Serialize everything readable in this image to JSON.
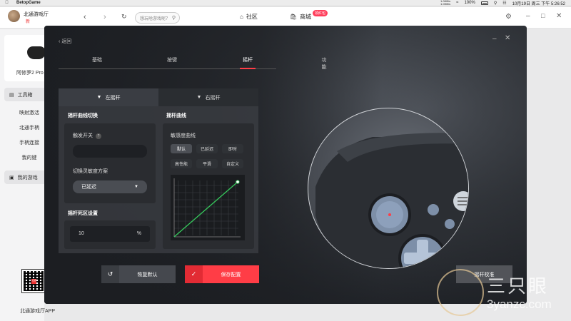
{
  "menubar": {
    "app_name": "BetopGame",
    "net_up": "1.0KB/s",
    "net_down": "1.0KB/s",
    "battery": "100%",
    "datetime": "10月19日 周三 下午 5:26:52"
  },
  "topbar": {
    "user_name": "北通游戏厅",
    "user_sub": "新",
    "search_placeholder": "想玩啥游戏呢？",
    "community_label": "社区",
    "mall_label": "商城",
    "mall_badge": "领红包"
  },
  "sidebar": {
    "device_name": "阿修罗2 Pro",
    "tools_label": "工具箱",
    "items": [
      "映射激活",
      "北通手柄",
      "手柄连接",
      "我的键"
    ],
    "games_label": "我的游戏",
    "qr_logo": "北通",
    "qr_label": "北通游戏厅APP"
  },
  "dialog": {
    "back_label": "返回",
    "tabs": [
      {
        "label": "基础",
        "active": false
      },
      {
        "label": "按键",
        "active": false
      },
      {
        "label": "摇杆",
        "active": true
      },
      {
        "label": "功能",
        "active": false
      }
    ],
    "stick_tabs": [
      {
        "label": "左摇杆",
        "active": true
      },
      {
        "label": "右摇杆",
        "active": false
      }
    ],
    "curve_switch_title": "摇杆曲线切换",
    "trigger_label": "触发开关",
    "sensitivity_scheme_label": "切换灵敏度方案",
    "sensitivity_scheme_value": "已延迟",
    "deadzone_title": "摇杆死区设置",
    "deadzone_value": "10",
    "deadzone_unit": "%",
    "curve_title": "摇杆曲线",
    "sensitivity_curve_label": "敏感度曲线",
    "curve_presets": [
      {
        "label": "默认",
        "active": true
      },
      {
        "label": "已延迟",
        "active": false
      },
      {
        "label": "即时",
        "active": false
      },
      {
        "label": "高性能",
        "active": false
      },
      {
        "label": "平滑",
        "active": false
      },
      {
        "label": "自定义",
        "active": false
      }
    ],
    "reset_label": "恢复默认",
    "save_label": "保存配置",
    "calibrate_label": "摇杆校准"
  },
  "watermark": {
    "cn": "三只眼",
    "en": "3yanzc.com"
  },
  "colors": {
    "accent": "#ff3d46",
    "curve_line": "#36c85c"
  }
}
